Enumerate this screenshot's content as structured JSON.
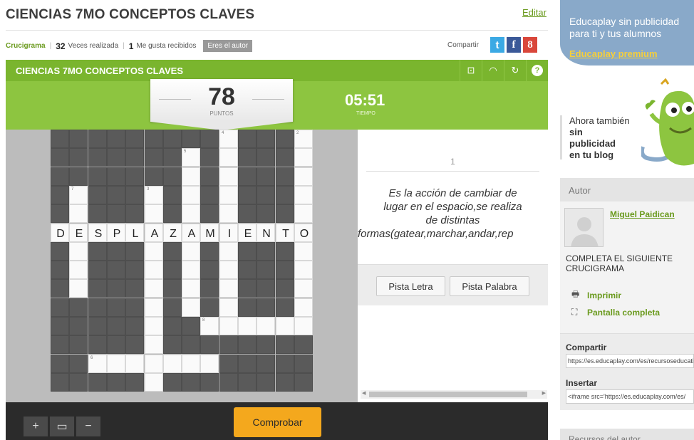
{
  "header": {
    "title": "CIENCIAS 7MO CONCEPTOS CLAVES",
    "edit_label": "Editar",
    "activity_type": "Crucigrama",
    "times_played": "32",
    "times_played_label": "Veces realizada",
    "likes": "1",
    "likes_label": "Me gusta recibidos",
    "author_badge": "Eres el autor",
    "share_label": "Compartir"
  },
  "social": {
    "twitter": "t",
    "facebook": "f",
    "google": "8"
  },
  "game": {
    "title": "CIENCIAS 7MO CONCEPTOS CLAVES",
    "score": "78",
    "score_label": "PUNTOS",
    "time": "05:51",
    "time_label": "TIEMPO",
    "toolbar_icons": [
      "grid-icon",
      "headphones-icon",
      "refresh-icon",
      "help-icon"
    ],
    "toolbar_glyphs": [
      "⊡",
      "◠",
      "↻",
      "?"
    ]
  },
  "crossword": {
    "solved_word": "DESPLAZAMIENTO",
    "letters": [
      "D",
      "E",
      "S",
      "P",
      "L",
      "A",
      "Z",
      "A",
      "M",
      "I",
      "E",
      "N",
      "T",
      "O"
    ],
    "clue_numbers": [
      "2",
      "4",
      "5",
      "7",
      "3",
      "8",
      "6"
    ]
  },
  "clue": {
    "number": "1",
    "lines": [
      "Es la acción de cambiar de",
      "lugar en el espacio,se realiza",
      "de distintas",
      "formas(gatear,marchar,andar,rep"
    ]
  },
  "hints": {
    "letter": "Pista Letra",
    "word": "Pista Palabra"
  },
  "footer": {
    "zoom_in": "+",
    "zoom_fit": "▭",
    "zoom_out": "−",
    "check": "Comprobar"
  },
  "sidebar": {
    "promo_text": "Educaplay sin publicidad para ti y tus alumnos",
    "promo_link": "Educaplay premium",
    "blog_line1": "Ahora también",
    "blog_line2": "sin publicidad",
    "blog_line3": "en tu blog",
    "author_heading": "Autor",
    "author_name": "Miguel Paidican",
    "author_desc": "COMPLETA EL SIGUIENTE CRUCIGRAMA",
    "print_label": "Imprimir",
    "fullscreen_label": "Pantalla completa",
    "share_heading": "Compartir",
    "share_url": "https://es.educaplay.com/es/recursoseducativos/",
    "embed_heading": "Insertar",
    "embed_code": "<iframe src='https://es.educaplay.com/es/",
    "resources_heading": "Recursos del autor"
  },
  "colors": {
    "green_dark": "#7ab52e",
    "green_light": "#8dc540",
    "orange": "#f4a81d",
    "sidebar_blue": "#89a9c9"
  }
}
